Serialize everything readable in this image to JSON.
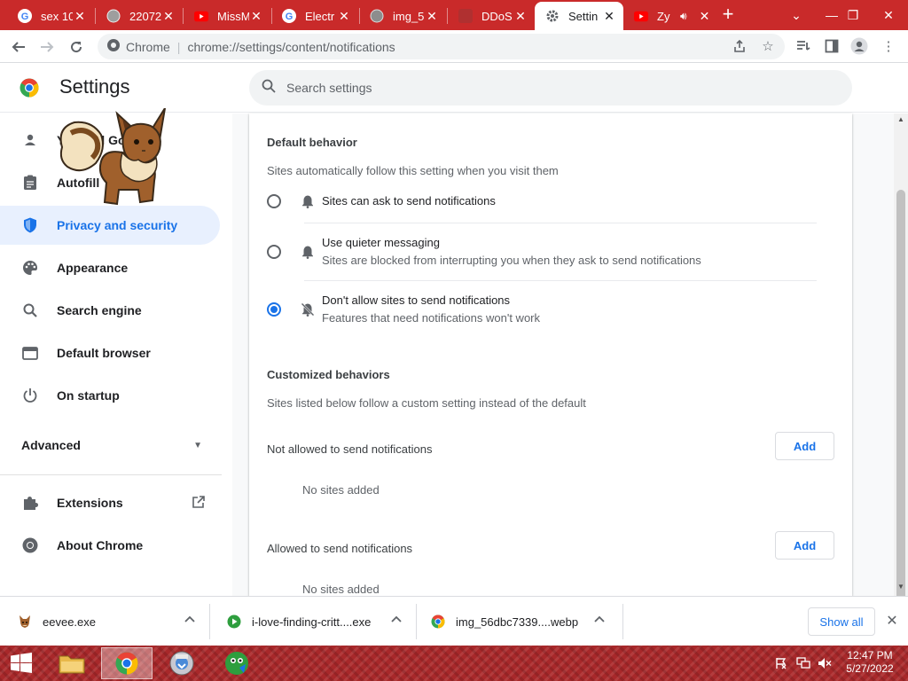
{
  "browser": {
    "tabs": [
      {
        "title": "sex 10",
        "icon": "google-g-icon"
      },
      {
        "title": "22072",
        "icon": "globe-icon"
      },
      {
        "title": "MissM",
        "icon": "youtube-icon"
      },
      {
        "title": "Electr",
        "icon": "google-g-icon"
      },
      {
        "title": "img_5",
        "icon": "globe-icon"
      },
      {
        "title": "DDoS",
        "icon": "red-square-icon"
      },
      {
        "title": "Settin",
        "icon": "gear-icon",
        "active": true
      },
      {
        "title": "Zy",
        "icon": "youtube-icon",
        "audio": true
      }
    ],
    "new_tab_label": "+",
    "omnibox": {
      "site_chip": "Chrome",
      "url": "chrome://settings/content/notifications"
    }
  },
  "settings": {
    "title": "Settings",
    "search_placeholder": "Search settings"
  },
  "sidebar": {
    "items": [
      {
        "label": "You and Google",
        "icon": "person-icon"
      },
      {
        "label": "Autofill",
        "icon": "clipboard-icon"
      },
      {
        "label": "Privacy and security",
        "icon": "shield-icon",
        "selected": true
      },
      {
        "label": "Appearance",
        "icon": "palette-icon"
      },
      {
        "label": "Search engine",
        "icon": "search-icon"
      },
      {
        "label": "Default browser",
        "icon": "browser-window-icon"
      },
      {
        "label": "On startup",
        "icon": "power-icon"
      }
    ],
    "advanced_label": "Advanced",
    "extensions_label": "Extensions",
    "about_label": "About Chrome"
  },
  "content": {
    "default_behavior_title": "Default behavior",
    "default_behavior_sub": "Sites automatically follow this setting when you visit them",
    "options": [
      {
        "label": "Sites can ask to send notifications",
        "sub": "",
        "checked": false
      },
      {
        "label": "Use quieter messaging",
        "sub": "Sites are blocked from interrupting you when they ask to send notifications",
        "checked": false
      },
      {
        "label": "Don't allow sites to send notifications",
        "sub": "Features that need notifications won't work",
        "checked": true
      }
    ],
    "custom_title": "Customized behaviors",
    "custom_sub": "Sites listed below follow a custom setting instead of the default",
    "not_allowed_label": "Not allowed to send notifications",
    "allowed_label": "Allowed to send notifications",
    "add_label": "Add",
    "no_sites_label": "No sites added"
  },
  "downloads": {
    "items": [
      {
        "name": "eevee.exe",
        "icon": "eevee-icon"
      },
      {
        "name": "i-love-finding-critt....exe",
        "icon": "green-play-icon"
      },
      {
        "name": "img_56dbc7339....webp",
        "icon": "chrome-icon"
      }
    ],
    "show_all_label": "Show all"
  },
  "taskbar": {
    "time": "12:47 PM",
    "date": "5/27/2022"
  },
  "colors": {
    "tab_strip": "#c92a2a",
    "accent": "#1a73e8",
    "taskbar": "#a8282a"
  }
}
